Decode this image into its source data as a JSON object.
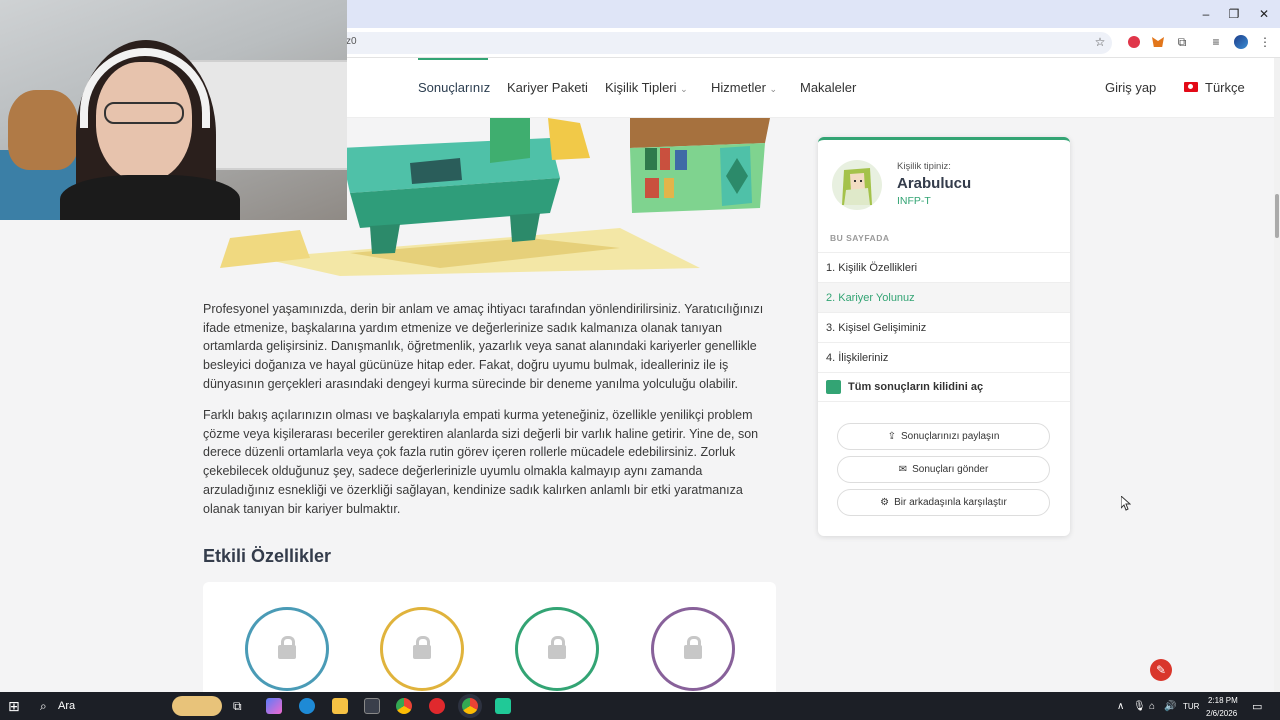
{
  "browser": {
    "url_fragment": "z0",
    "window_controls": {
      "minimize": "–",
      "restore": "❐",
      "close": "✕"
    }
  },
  "nav": {
    "items": [
      {
        "label": "Sonuçlarınız",
        "icon": ""
      },
      {
        "label": "Kariyer Paketi",
        "icon": ""
      },
      {
        "label": "Kişilik Tipleri",
        "icon": "chevron-down-icon"
      },
      {
        "label": "Hizmetler",
        "icon": "chevron-down-icon"
      },
      {
        "label": "Makaleler",
        "icon": ""
      }
    ],
    "login": "Giriş yap",
    "language": "Türkçe"
  },
  "content": {
    "para1": "Profesyonel yaşamınızda, derin bir anlam ve amaç ihtiyacı tarafından yönlendirilirsiniz. Yaratıcılığınızı ifade etmenize, başkalarına yardım etmenize ve değerlerinize sadık kalmanıza olanak tanıyan ortamlarda gelişirsiniz. Danışmanlık, öğretmenlik, yazarlık veya sanat alanındaki kariyerler genellikle besleyici doğanıza ve hayal gücünüze hitap eder. Fakat, doğru uyumu bulmak, idealleriniz ile iş dünyasının gerçekleri arasındaki dengeyi kurma sürecinde bir deneme yanılma yolculuğu olabilir.",
    "para2": "Farklı bakış açılarınızın olması ve başkalarıyla empati kurma yeteneğiniz, özellikle yenilikçi problem çözme veya kişilerarası beceriler gerektiren alanlarda sizi değerli bir varlık haline getirir. Yine de, son derece düzenli ortamlarla veya çok fazla rutin görev içeren rollerle mücadele edebilirsiniz. Zorluk çekebilecek olduğunuz şey, sadece değerlerinizle uyumlu olmakla kalmayıp aynı zamanda arzuladığınız esnekliği ve özerkliği sağlayan, kendinize sadık kalırken anlamlı bir etki yaratmanıza olanak tanıyan bir kariyer bulmaktır.",
    "section_title": "Etkili Özellikler",
    "trait_colors": [
      "#4a9bb6",
      "#e0b33c",
      "#33a474",
      "#88619a"
    ]
  },
  "sidebar": {
    "type_label": "Kişilik tipiniz:",
    "type_name": "Arabulucu",
    "type_code": "INFP-T",
    "on_this_page": "BU SAYFADA",
    "menu": [
      "1. Kişilik Özellikleri",
      "2. Kariyer Yolunuz",
      "3. Kişisel Gelişiminiz",
      "4. İlişkileriniz"
    ],
    "unlock": "Tüm sonuçların kilidini aç",
    "share": "Sonuçlarınızı paylaşın",
    "send": "Sonuçları gönder",
    "compare": "Bir arkadaşınla karşılaştır"
  },
  "taskbar": {
    "search": "Ara",
    "lang": "TUR",
    "time": "2:18 PM",
    "date": "2/6/2026"
  },
  "colors": {
    "accent": "#33a474",
    "navy": "#343c4b"
  }
}
